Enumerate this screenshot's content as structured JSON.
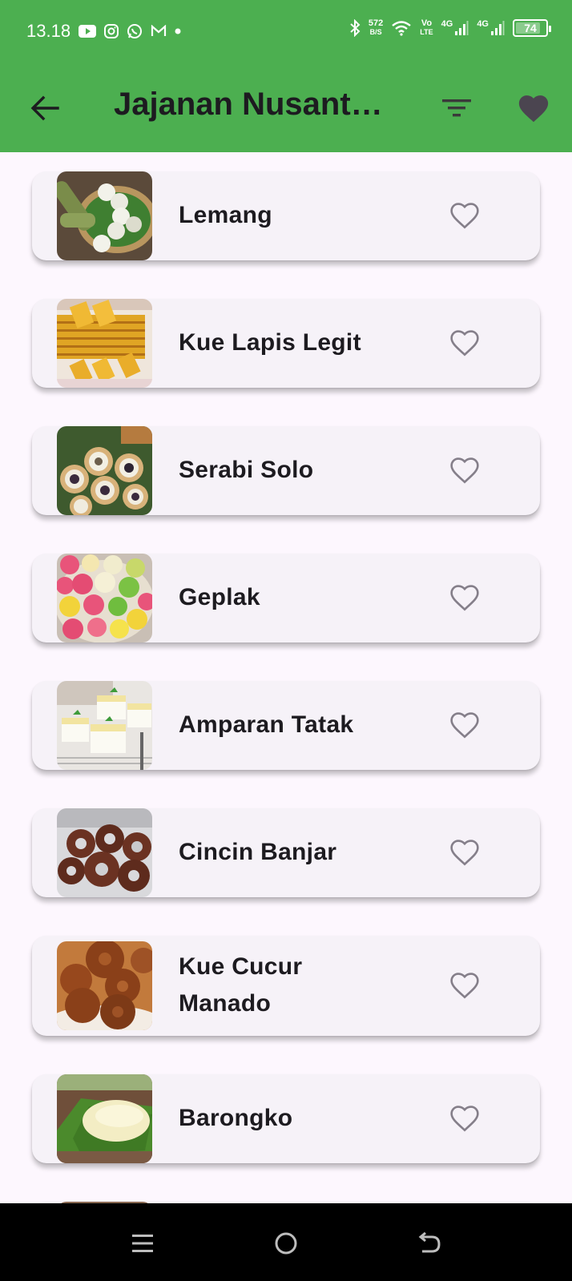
{
  "status_bar": {
    "time": "13.18",
    "net_speed_value": "572",
    "net_speed_unit": "B/S",
    "volte_top": "Vo",
    "volte_bottom": "LTE",
    "signal1_label": "4G",
    "signal2_label": "4G",
    "battery_level": "74"
  },
  "app_bar": {
    "title": "Jajanan Nusantara"
  },
  "items": [
    {
      "name": "Lemang"
    },
    {
      "name": "Kue Lapis Legit"
    },
    {
      "name": "Serabi Solo"
    },
    {
      "name": "Geplak"
    },
    {
      "name": "Amparan Tatak"
    },
    {
      "name": "Cincin Banjar"
    },
    {
      "name": "Kue Cucur\nManado"
    },
    {
      "name": "Barongko"
    }
  ],
  "colors": {
    "app_bar_bg": "#4caf50",
    "card_bg": "#f6f2f8",
    "page_bg": "#fdf7fe",
    "heart_outline": "#857f8a"
  }
}
